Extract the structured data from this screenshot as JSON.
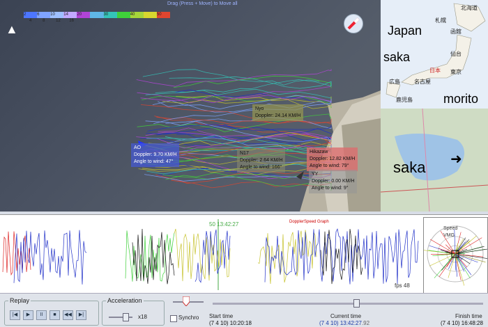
{
  "app": {
    "drag_hint": "Drag (Press + Move) to Move all"
  },
  "speed_legend": {
    "upper_ticks": [
      "2",
      "6",
      "10",
      "14",
      "20",
      "",
      "30",
      "",
      "40",
      "",
      "50"
    ],
    "lower_ticks": [
      "4",
      "8",
      "12",
      "16",
      "",
      "",
      "",
      "",
      "",
      "",
      ""
    ]
  },
  "compass": {
    "north_label": "N"
  },
  "boats": [
    {
      "id": "ao",
      "name": "AO",
      "doppler": "Doppler: 9.70 KM/H",
      "angle": "Angle to wind: 47°"
    },
    {
      "id": "nyo",
      "name": "Nyo",
      "doppler": "Doppler: 24.14 KM/H",
      "angle": ""
    },
    {
      "id": "n17",
      "name": "N17",
      "doppler": "Doppler: 2.64 KM/H",
      "angle": "Angle to wind: 166°"
    },
    {
      "id": "hikazaw",
      "name": "Hikazaw",
      "doppler": "Doppler: 12.82 KM/H",
      "angle": "Angle to wind: 79°"
    },
    {
      "id": "yy",
      "name": "YY",
      "doppler": "Doppler: 0.00 KM/H",
      "angle": "Angle to wind: 9°"
    }
  ],
  "inset_map": {
    "title": "Japan",
    "place_left": "saka",
    "place_right": "morito",
    "city_labels": [
      "札幌",
      "北海道",
      "函館",
      "仙台",
      "日本",
      "東京",
      "広島",
      "名古屋",
      "鹿児島"
    ],
    "detail_label": "saka"
  },
  "graph": {
    "title": "DopplerSpeed Graph",
    "marker_left": "50",
    "marker_time": "13:42:27",
    "fps": "fps 48"
  },
  "polar": {
    "labels": [
      "Speed",
      "VMG"
    ]
  },
  "controls": {
    "replay_title": "Replay",
    "acceleration_title": "Acceleration",
    "accel_value": "x18",
    "synchro_label": "Synchro",
    "start_label": "Start time",
    "start_value": "(7 4 10) 10:20:18",
    "current_label": "Current time",
    "current_date": "(7 4 10)",
    "current_time": "13:42:27",
    "current_frac": ".92",
    "finish_label": "Finish time",
    "finish_value": "(7 4 10) 16:48:28",
    "playback_progress": 0.52
  },
  "colors": {
    "accent": "#1a3aa8",
    "track_blue": "#1f2fc8",
    "track_yellow": "#c6c22a",
    "track_green": "#3fcf3a",
    "track_red": "#d22",
    "track_black": "#111"
  }
}
